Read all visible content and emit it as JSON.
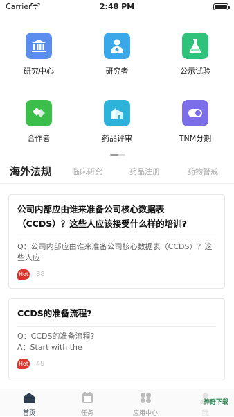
{
  "status_bar": {
    "carrier": "Carrier",
    "time": "2:48 PM"
  },
  "grid": [
    {
      "label": "研究中心",
      "icon": "institution-icon",
      "color": "#5b8def"
    },
    {
      "label": "研究者",
      "icon": "doctor-icon",
      "color": "#3aa8e8"
    },
    {
      "label": "公示试验",
      "icon": "flask-icon",
      "color": "#2fc27a"
    },
    {
      "label": "合作者",
      "icon": "handshake-icon",
      "color": "#3bbf4a"
    },
    {
      "label": "药品评审",
      "icon": "building-icon",
      "color": "#2db3d9"
    },
    {
      "label": "TNM分期",
      "icon": "toggle-icon",
      "color": "#7b6ee8"
    }
  ],
  "tabs": [
    {
      "label": "海外法规",
      "active": true
    },
    {
      "label": "临床研究",
      "active": false
    },
    {
      "label": "药品注册",
      "active": false
    },
    {
      "label": "药物警戒",
      "active": false
    }
  ],
  "cards": [
    {
      "title": "公司内部应由谁来准备公司核心数据表（CCDS）？这些人应该接受什么样的培训?",
      "q": "Q：公司内部应由谁来准备公司核心数据表（CCDS）？这些人应",
      "a": "",
      "hot": "Hot",
      "views": "88"
    },
    {
      "title": "CCDS的准备流程?",
      "q": "Q：CCDS的准备流程?",
      "a": "A：Start with the",
      "hot": "Hot",
      "views": "49"
    }
  ],
  "bottom_nav": [
    {
      "label": "首页",
      "icon": "home-icon",
      "active": true
    },
    {
      "label": "任务",
      "icon": "calendar-icon",
      "active": false
    },
    {
      "label": "应用中心",
      "icon": "apps-icon",
      "active": false
    },
    {
      "label": "我",
      "icon": "user-icon",
      "active": false
    }
  ],
  "watermark": "神奇下载",
  "colors": {
    "hot": "#d9362b",
    "active_nav": "#2c3e50"
  }
}
